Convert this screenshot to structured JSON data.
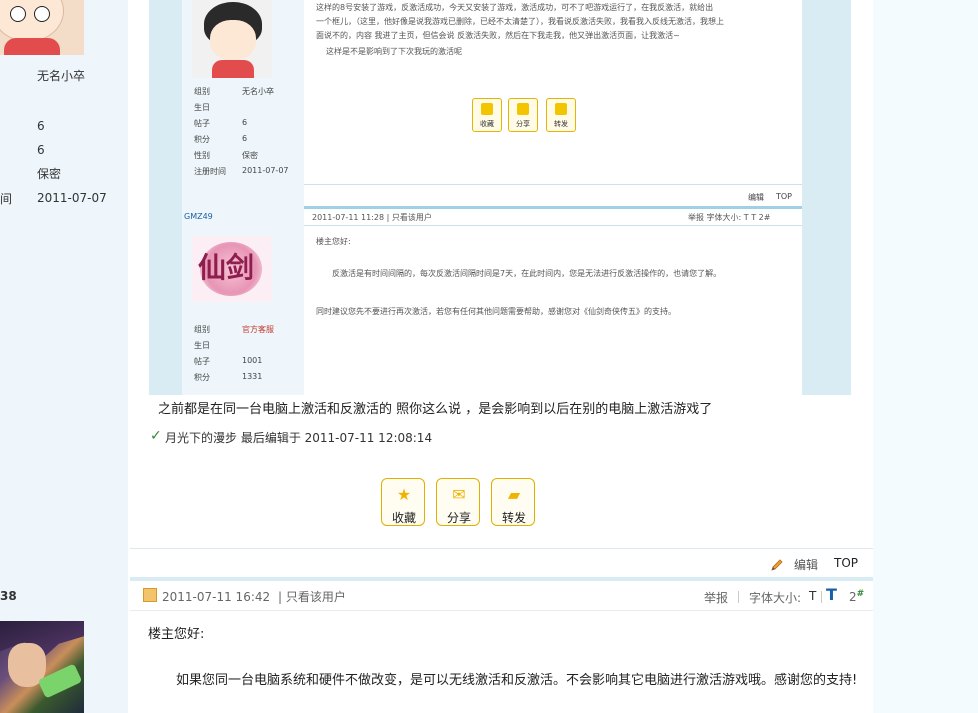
{
  "left_user": {
    "name": "无名小卒",
    "values": [
      "6",
      "6",
      "保密",
      "2011-07-07"
    ],
    "cut_label": "间"
  },
  "next_floor_no": "38",
  "embedded": {
    "user1": {
      "rows": [
        {
          "k": "组别",
          "v": "无名小卒"
        },
        {
          "k": "生日",
          "v": ""
        },
        {
          "k": "帖子",
          "v": "6"
        },
        {
          "k": "积分",
          "v": "6"
        },
        {
          "k": "性别",
          "v": "保密"
        },
        {
          "k": "注册时间",
          "v": "2011-07-07"
        }
      ]
    },
    "post_lines": [
      "这样的8号安装了游戏，反激活成功，今天又安装了游戏，激活成功，可不了吧游戏运行了，在我反激活，就给出",
      "一个框儿，（这里，他好像是说我游戏已删除，已经不太清楚了），我看说反激活失败，我看我入反线无激活，我想上",
      "面说不的，内容 我进了主页，但信会说 反激活失败，然后在下我走我，他又弹出激活页面，让我激活~",
      "这样是不是影响到了下次我玩的激活呢"
    ],
    "buttons": [
      "收藏",
      "分享",
      "转发"
    ],
    "edit": "编辑",
    "top": "TOP",
    "user2": {
      "name": "GMZ49",
      "avatar_text": "仙剑",
      "rows": [
        {
          "k": "组别",
          "v": "官方客服"
        },
        {
          "k": "生日",
          "v": ""
        },
        {
          "k": "帖子",
          "v": "1001"
        },
        {
          "k": "积分",
          "v": "1331"
        }
      ]
    },
    "reply_head": "2011-07-11 11:28 | 只看该用户",
    "reply_tools": "举报  字体大小:  T  T  2#",
    "reply_lines": [
      "楼主您好:",
      "反激活是有时间间隔的，每次反激活间隔时间是7天，在此时间内，您是无法进行反激活操作的，也请您了解。",
      "同时建议您先不要进行再次激活，若您有任何其他问题需要帮助，感谢您对《仙剑奇侠传五》的支持。"
    ]
  },
  "reply_text": "之前都是在同一台电脑上激活和反激活的   照你这么说 ，是会影响到以后在别的电脑上激活游戏了",
  "edit_info": "月光下的漫步  最后编辑于  2011-07-11 12:08:14",
  "actions": [
    {
      "icon": "★",
      "label": "收藏"
    },
    {
      "icon": "✉",
      "label": "分享"
    },
    {
      "icon": "▰",
      "label": "转发"
    }
  ],
  "edit_label": "编辑",
  "top_label": "TOP",
  "next_post": {
    "time": "2011-07-11 16:42",
    "only_user": "| 只看该用户",
    "report": "举报",
    "font_size": "字体大小:",
    "t_small": "T",
    "t_big": "T",
    "floor": "2",
    "floor_mark": "#",
    "greeting": "楼主您好:",
    "body": "如果您同一台电脑系统和硬件不做改变，是可以无线激活和反激活。不会影响其它电脑进行激活游戏哦。感谢您的支持!"
  }
}
